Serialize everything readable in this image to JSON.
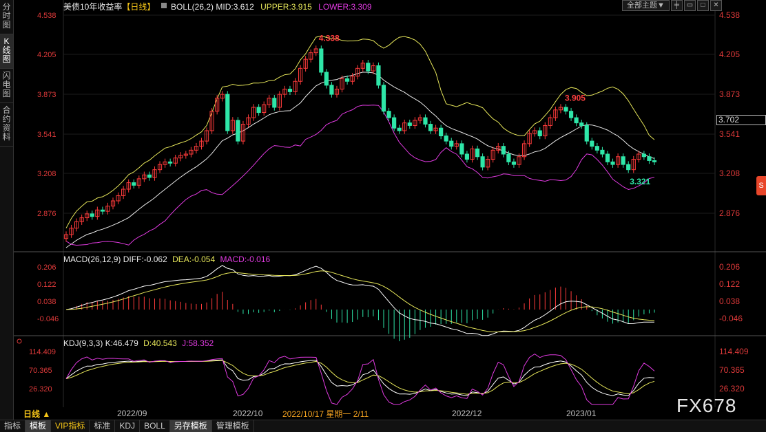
{
  "left_tabs": [
    {
      "label": "分时图",
      "active": false
    },
    {
      "label": "K线图",
      "active": true
    },
    {
      "label": "闪电图",
      "active": false
    },
    {
      "label": "合约资料",
      "active": false
    }
  ],
  "header": {
    "title": "美债10年收益率",
    "period_tag": "【日线】",
    "boll_label": "BOLL(26,2)",
    "mid_label": "MID:3.612",
    "upper_label": "UPPER:3.915",
    "lower_label": "LOWER:3.309",
    "theme_button": "全部主题▼"
  },
  "price_axis": [
    "4.538",
    "4.205",
    "3.873",
    "3.541",
    "3.208",
    "2.876"
  ],
  "current_price_tag": "3.702",
  "annotations": {
    "high": "4.338",
    "recent_high": "3.905",
    "low": "3.321"
  },
  "macd": {
    "label": "MACD(26,12,9)",
    "diff_label": "DIFF:-0.062",
    "dea_label": "DEA:-0.054",
    "macd_label": "MACD:-0.016",
    "axis": [
      "0.206",
      "0.122",
      "0.038",
      "-0.046"
    ]
  },
  "kdj": {
    "label": "KDJ(9,3,3)",
    "k_label": "K:46.479",
    "d_label": "D:40.543",
    "j_label": "J:58.352",
    "axis": [
      "114.409",
      "70.365",
      "26.320"
    ]
  },
  "date_axis": {
    "period": "日线 ▲",
    "labels": [
      "2022/09",
      "2022/10",
      "2022/12",
      "2023/01"
    ],
    "crosshair": "2022/10/17 星期一 2/11"
  },
  "bottom_tabs": [
    {
      "label": "指标",
      "active": false,
      "vip": false
    },
    {
      "label": "模板",
      "active": true,
      "vip": false
    },
    {
      "label": "VIP指标",
      "active": false,
      "vip": true
    },
    {
      "label": "标准",
      "active": false,
      "vip": false
    },
    {
      "label": "KDJ",
      "active": false,
      "vip": false
    },
    {
      "label": "BOLL",
      "active": false,
      "vip": false
    },
    {
      "label": "另存模板",
      "active": true,
      "vip": false
    },
    {
      "label": "管理模板",
      "active": false,
      "vip": false
    }
  ],
  "watermark": "FX678",
  "colors": {
    "up": "#ff3b3b",
    "down": "#2ee6a8",
    "boll_upper": "#e6e65a",
    "boll_mid": "#e8e8e8",
    "boll_lower": "#e03ae0",
    "dea": "#e6e65a",
    "diff": "#ffffff"
  },
  "chart_data": {
    "type": "candlestick",
    "y_range": [
      2.8,
      4.6
    ],
    "close": [
      2.9,
      2.95,
      3.0,
      3.03,
      3.06,
      3.04,
      3.09,
      3.08,
      3.12,
      3.16,
      3.2,
      3.25,
      3.3,
      3.28,
      3.33,
      3.36,
      3.34,
      3.4,
      3.44,
      3.46,
      3.45,
      3.49,
      3.51,
      3.52,
      3.55,
      3.58,
      3.62,
      3.7,
      3.85,
      3.95,
      3.98,
      3.7,
      3.78,
      3.62,
      3.75,
      3.8,
      3.88,
      3.84,
      3.9,
      3.95,
      3.88,
      3.98,
      4.02,
      4.0,
      4.08,
      4.18,
      4.25,
      4.3,
      4.33,
      4.15,
      4.05,
      3.98,
      4.02,
      4.1,
      4.08,
      4.12,
      4.18,
      4.22,
      4.16,
      4.2,
      4.05,
      3.85,
      3.8,
      3.72,
      3.7,
      3.76,
      3.74,
      3.78,
      3.8,
      3.75,
      3.7,
      3.72,
      3.66,
      3.62,
      3.58,
      3.6,
      3.52,
      3.48,
      3.56,
      3.5,
      3.42,
      3.48,
      3.55,
      3.58,
      3.52,
      3.46,
      3.44,
      3.5,
      3.6,
      3.68,
      3.7,
      3.66,
      3.74,
      3.8,
      3.86,
      3.88,
      3.85,
      3.8,
      3.76,
      3.74,
      3.62,
      3.58,
      3.55,
      3.52,
      3.46,
      3.44,
      3.5,
      3.44,
      3.4,
      3.48,
      3.52,
      3.5,
      3.47,
      3.46
    ]
  }
}
